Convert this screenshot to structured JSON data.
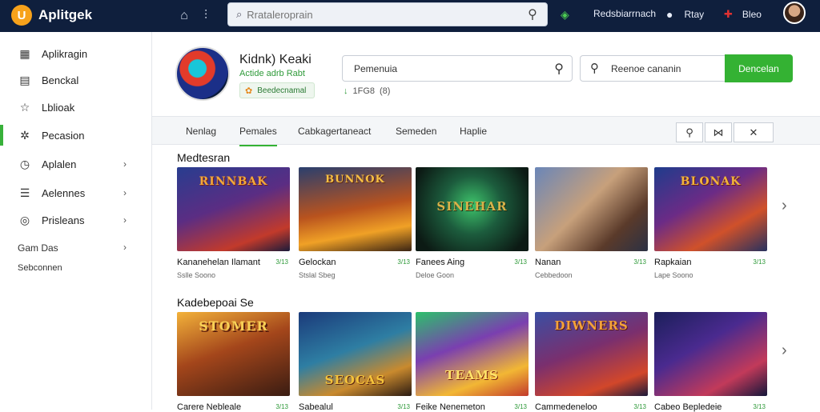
{
  "topbar": {
    "logo_text": "Aplitgek",
    "search_placeholder": "Rrataleroprain",
    "item1": "Redsbiarrnach",
    "item2": "Rtay",
    "item3": "Bleo"
  },
  "sidebar": {
    "items": [
      {
        "label": "Aplikragin",
        "icon": "grid-icon"
      },
      {
        "label": "Benckal",
        "icon": "book-icon"
      },
      {
        "label": "Lblioak",
        "icon": "star-icon"
      },
      {
        "label": "Pecasion",
        "icon": "puzzle-icon"
      },
      {
        "label": "Aplalen",
        "icon": "clock-icon"
      },
      {
        "label": "Aelennes",
        "icon": "list-icon"
      },
      {
        "label": "Prisleans",
        "icon": "target-icon"
      }
    ],
    "plain1": "Gam Das",
    "plain2": "Sebconnen"
  },
  "app": {
    "title": "Kidnk) Keaki",
    "developer": "Actide adrb Rabt",
    "tag": "Beedecnamal",
    "downloads": "1FG8",
    "size": "(8)"
  },
  "fields": {
    "field1_value": "Pemenuia",
    "field2_value": "Reenoe cananin",
    "green_button": "Dencelan"
  },
  "tabs": [
    "Nenlag",
    "Pemales",
    "Cabkagertaneact",
    "Semeden",
    "Haplie"
  ],
  "sections": [
    {
      "title": "Medtesran",
      "cards": [
        {
          "name": "Kananehelan Ilamant",
          "rating": "3/13",
          "sub": "Sslle Soono"
        },
        {
          "name": "Gelockan",
          "rating": "3/13",
          "sub": "Stslal Sbeg"
        },
        {
          "name": "Fanees Aing",
          "rating": "3/13",
          "sub": "Deloe Goon"
        },
        {
          "name": "Nanan",
          "rating": "3/13",
          "sub": "Cebbedoon"
        },
        {
          "name": "Rapkaian",
          "rating": "3/13",
          "sub": "Lape Soono"
        }
      ]
    },
    {
      "title": "Kadebepoai Se",
      "cards": [
        {
          "name": "Carere Nebleale",
          "rating": "3/13",
          "sub": ""
        },
        {
          "name": "Sabealul",
          "rating": "3/13",
          "sub": ""
        },
        {
          "name": "Feike Nenemeton",
          "rating": "3/13",
          "sub": ""
        },
        {
          "name": "Cammedeneloo",
          "rating": "3/13",
          "sub": ""
        },
        {
          "name": "Cabeo Bepledeie",
          "rating": "3/13",
          "sub": ""
        }
      ]
    }
  ],
  "artwork": {
    "row1": [
      "RINNBAK",
      "BUNNOK",
      "SINEHAR",
      "",
      "BLONAK"
    ],
    "row2": [
      "STOMER",
      "SEOCAS",
      "TEAMS",
      "DIWNERS",
      ""
    ]
  },
  "colors": {
    "topbar_bg": "#0f1f3d",
    "accent_green": "#34b233",
    "logo_orange": "#f7a21b"
  }
}
